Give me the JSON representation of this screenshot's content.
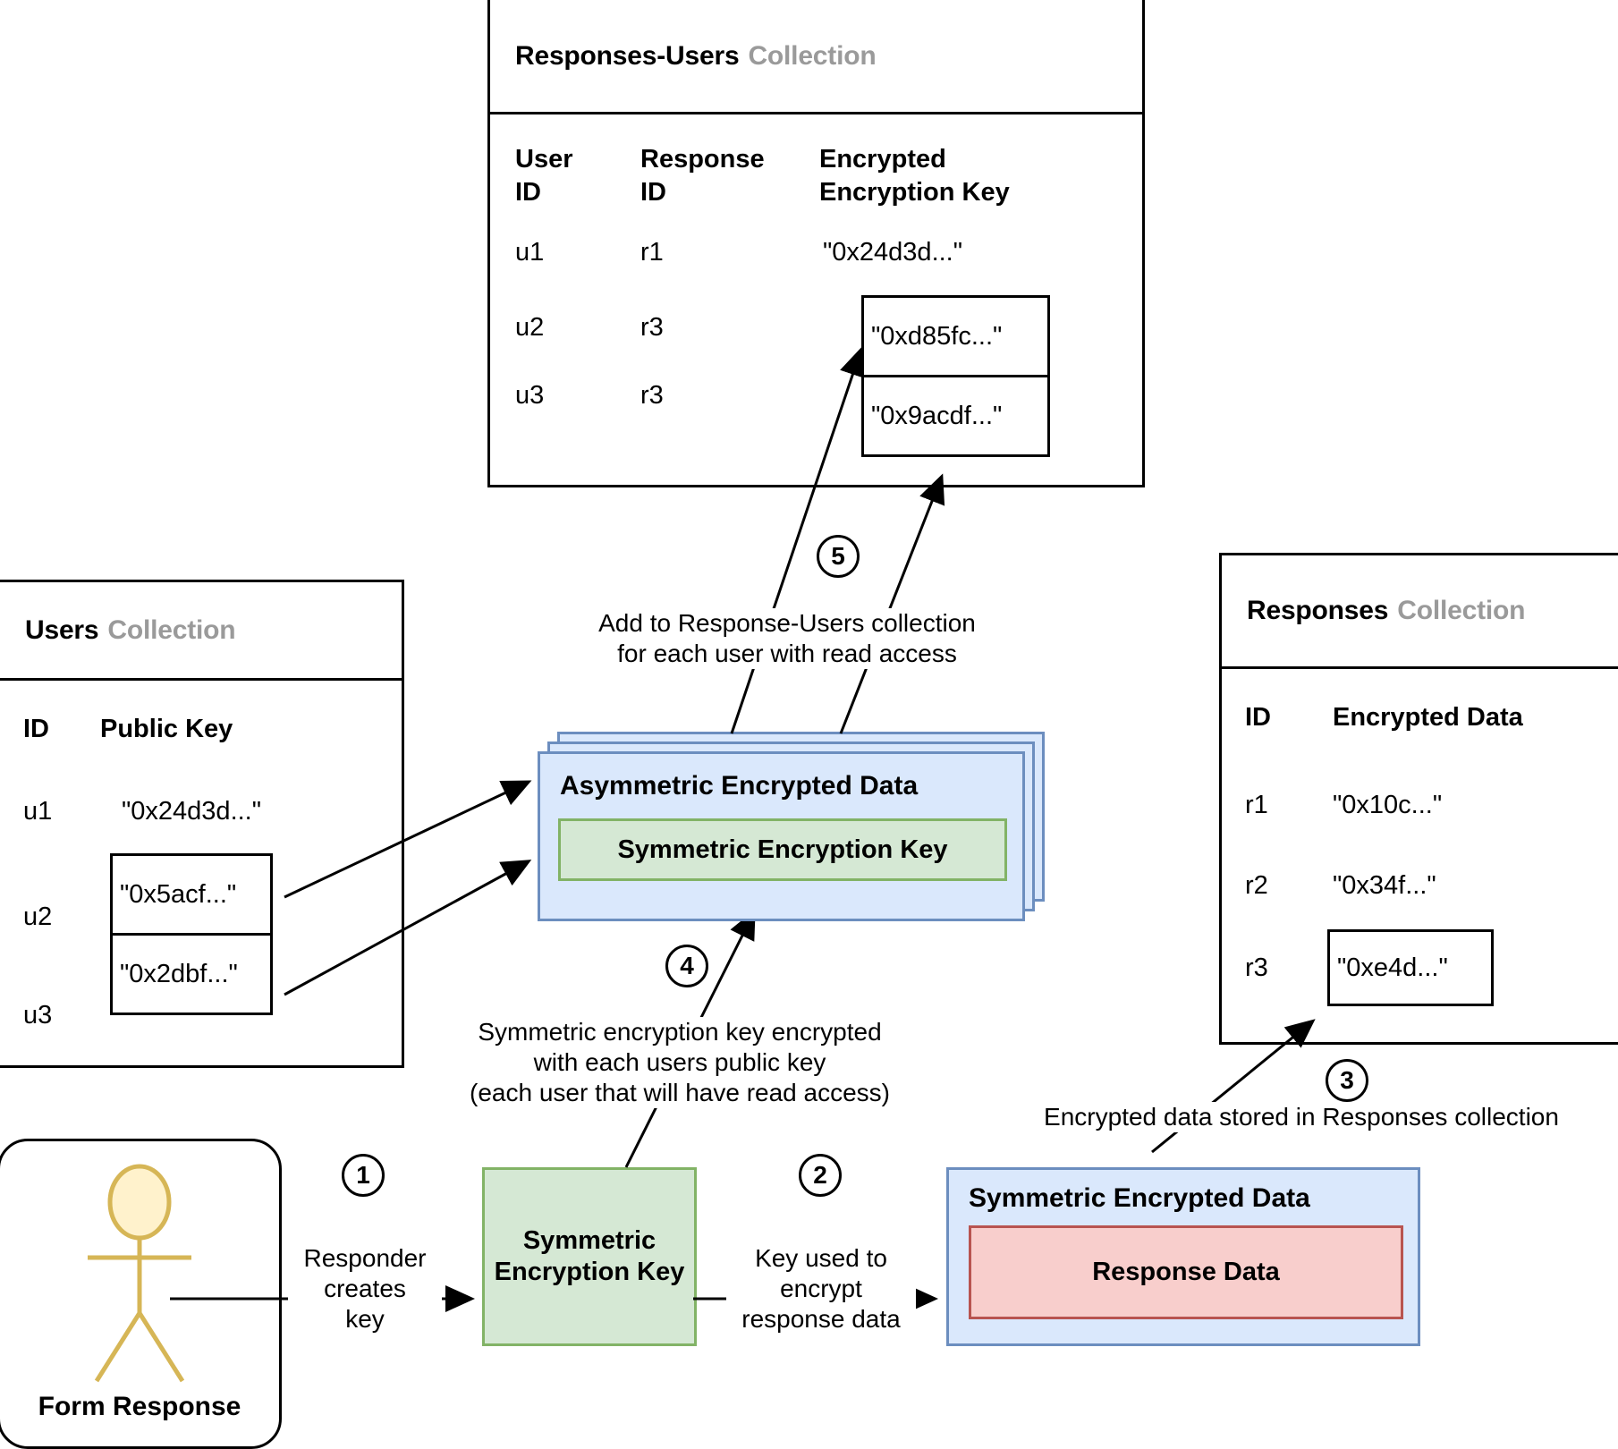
{
  "diagram": {
    "title_hidden": "Form response end-to-end encryption flow"
  },
  "responses_users_collection": {
    "name": "Responses-Users",
    "suffix": "Collection",
    "columns": [
      "User ID",
      "Response ID",
      "Encrypted Encryption Key"
    ],
    "columns_split": [
      {
        "l1": "User",
        "l2": "ID"
      },
      {
        "l1": "Response",
        "l2": "ID"
      },
      {
        "l1": "Encrypted",
        "l2": "Encryption Key"
      }
    ],
    "rows": [
      {
        "user_id": "u1",
        "response_id": "r1",
        "key": "\"0x24d3d...\"",
        "highlighted": false
      },
      {
        "user_id": "u2",
        "response_id": "r3",
        "key": "\"0xd85fc...\"",
        "highlighted": true
      },
      {
        "user_id": "u3",
        "response_id": "r3",
        "key": "\"0x9acdf...\"",
        "highlighted": true
      }
    ]
  },
  "users_collection": {
    "name": "Users",
    "suffix": "Collection",
    "columns": [
      "ID",
      "Public Key"
    ],
    "rows": [
      {
        "id": "u1",
        "public_key": "\"0x24d3d...\"",
        "highlighted": false
      },
      {
        "id": "u2",
        "public_key": "\"0x5acf...\"",
        "highlighted": true
      },
      {
        "id": "u3",
        "public_key": "\"0x2dbf...\"",
        "highlighted": true
      }
    ]
  },
  "responses_collection": {
    "name": "Responses",
    "suffix": "Collection",
    "columns": [
      "ID",
      "Encrypted Data"
    ],
    "rows": [
      {
        "id": "r1",
        "encrypted_data": "\"0x10c...\"",
        "highlighted": false
      },
      {
        "id": "r2",
        "encrypted_data": "\"0x34f...\"",
        "highlighted": false
      },
      {
        "id": "r3",
        "encrypted_data": "\"0xe4d...\"",
        "highlighted": true
      }
    ]
  },
  "actor": {
    "label": "Form Response",
    "icon": "stick-figure-person",
    "color": "#d6b656"
  },
  "nodes": {
    "symmetric_key": {
      "label": "Symmetric Encryption Key",
      "fill": "#d5e8d4",
      "stroke": "#82b366"
    },
    "symmetric_encrypted_data": {
      "label": "Symmetric Encrypted Data",
      "fill": "#dae8fc",
      "stroke": "#6c8ebf"
    },
    "response_data": {
      "label": "Response Data",
      "fill": "#f8cecc",
      "stroke": "#b85450"
    },
    "asymmetric_encrypted_data": {
      "label": "Asymmetric Encrypted Data",
      "fill": "#dae8fc",
      "stroke": "#6c8ebf"
    },
    "inner_symmetric_key": {
      "label": "Symmetric Encryption Key",
      "fill": "#d5e8d4",
      "stroke": "#82b366"
    }
  },
  "steps": [
    {
      "number": "1",
      "label": "Responder\ncreates\nkey"
    },
    {
      "number": "2",
      "label": "Key used to\nencrypt\nresponse data"
    },
    {
      "number": "3",
      "label": "Encrypted data stored in Responses collection"
    },
    {
      "number": "4",
      "label": "Symmetric encryption key encrypted\nwith each users public key\n(each user that will have read access)"
    },
    {
      "number": "5",
      "label": "Add to Response-Users collection\nfor each user with read access"
    }
  ]
}
